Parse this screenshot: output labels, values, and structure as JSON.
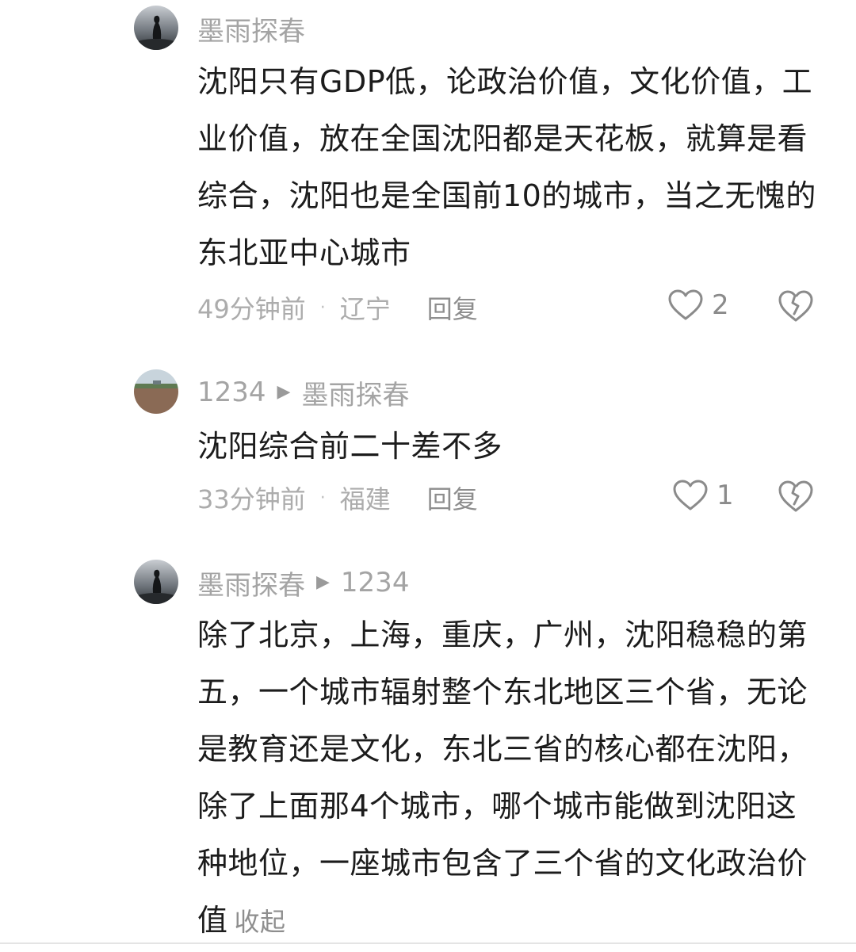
{
  "comments": [
    {
      "author": "墨雨探春",
      "reply_to": "",
      "text": "沈阳只有GDP低，论政治价值，文化价值，工业价值，放在全国沈阳都是天花板，就算是看综合，沈阳也是全国前10的城市，当之无愧的东北亚中心城市",
      "time": "49分钟前",
      "location": "辽宁",
      "reply_label": "回复",
      "likes": "2",
      "avatar_icon": "avatar-silhouette-dark-sky"
    },
    {
      "author": "1234",
      "reply_to": "墨雨探春",
      "text": "沈阳综合前二十差不多",
      "time": "33分钟前",
      "location": "福建",
      "reply_label": "回复",
      "likes": "1",
      "avatar_icon": "avatar-field-landscape"
    },
    {
      "author": "墨雨探春",
      "reply_to": "1234",
      "text": "除了北京，上海，重庆，广州，沈阳稳稳的第五，一个城市辐射整个东北地区三个省，无论是教育还是文化，东北三省的核心都在沈阳，除了上面那4个城市，哪个城市能做到沈阳这种地位，一座城市包含了三个省的文化政治价值",
      "collapse_label": "收起",
      "avatar_icon": "avatar-silhouette-dark-sky"
    }
  ],
  "separator": "·",
  "reply_arrow": "▶",
  "icons": {
    "like": "heart-outline-icon",
    "dislike": "broken-heart-icon"
  },
  "colors": {
    "text": "#1c1c1c",
    "muted": "#a4a4a4",
    "icon": "#8b8b8b"
  }
}
